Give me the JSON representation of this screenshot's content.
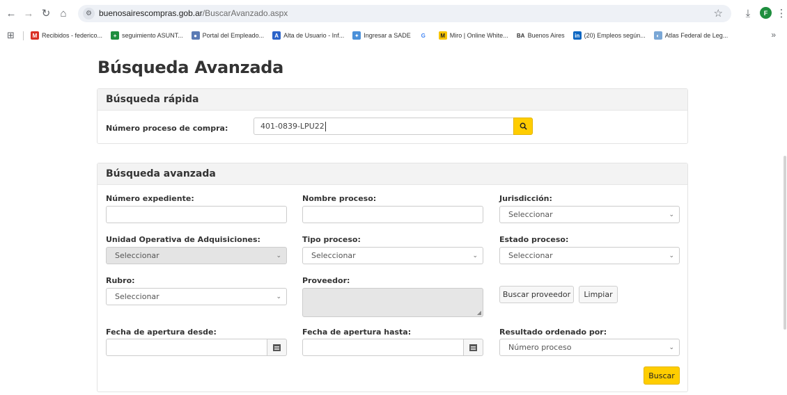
{
  "browser": {
    "url_host": "buenosairescompras.gob.ar",
    "url_path": "/BuscarAvanzado.aspx",
    "profile_initial": "F",
    "bookmarks": [
      {
        "label": "Recibidos - federico...",
        "icon": "gmail-icon",
        "color": "#d93025",
        "glyph": "M"
      },
      {
        "label": "seguimiento ASUNT...",
        "icon": "sheets-icon",
        "color": "#1e8e3e",
        "glyph": "+"
      },
      {
        "label": "Portal del Empleado...",
        "icon": "portal-icon",
        "color": "#5b7bb5",
        "glyph": "●"
      },
      {
        "label": "Alta de Usuario - Inf...",
        "icon": "alta-icon",
        "color": "#2b63c9",
        "glyph": "A"
      },
      {
        "label": "Ingresar a SADE",
        "icon": "sade-icon",
        "color": "#4a90d9",
        "glyph": "✦"
      },
      {
        "label": "",
        "icon": "google-icon",
        "color": "#ffffff",
        "glyph": "G"
      },
      {
        "label": "Miro | Online White...",
        "icon": "miro-icon",
        "color": "#f7c400",
        "glyph": "M"
      },
      {
        "label": "Buenos Aires",
        "icon": "ba-icon",
        "color": "#ffffff",
        "glyph": "BA"
      },
      {
        "label": "(20) Empleos según...",
        "icon": "linkedin-icon",
        "color": "#0a66c2",
        "glyph": "in"
      },
      {
        "label": "Atlas Federal de Leg...",
        "icon": "atlas-icon",
        "color": "#7aa7d6",
        "glyph": "◐"
      }
    ],
    "more": "»"
  },
  "page": {
    "title": "Búsqueda Avanzada",
    "quick": {
      "heading": "Búsqueda rápida",
      "label": "Número proceso de compra:",
      "value": "401-0839-LPU22"
    },
    "advanced": {
      "heading": "Búsqueda avanzada",
      "numero_expediente": {
        "label": "Número expediente:",
        "value": ""
      },
      "nombre_proceso": {
        "label": "Nombre proceso:",
        "value": ""
      },
      "jurisdiccion": {
        "label": "Jurisdicción:",
        "value": "Seleccionar"
      },
      "unidad_operativa": {
        "label": "Unidad Operativa de Adquisiciones:",
        "value": "Seleccionar"
      },
      "tipo_proceso": {
        "label": "Tipo proceso:",
        "value": "Seleccionar"
      },
      "estado_proceso": {
        "label": "Estado proceso:",
        "value": "Seleccionar"
      },
      "rubro": {
        "label": "Rubro:",
        "value": "Seleccionar"
      },
      "proveedor": {
        "label": "Proveedor:",
        "value": ""
      },
      "buscar_proveedor": "Buscar proveedor",
      "limpiar": "Limpiar",
      "fecha_desde": {
        "label": "Fecha de apertura desde:",
        "value": ""
      },
      "fecha_hasta": {
        "label": "Fecha de apertura hasta:",
        "value": ""
      },
      "orden": {
        "label": "Resultado ordenado por:",
        "value": "Número proceso"
      },
      "buscar": "Buscar"
    }
  },
  "colors": {
    "accent": "#ffcd00",
    "accent_border": "#e3b400"
  }
}
